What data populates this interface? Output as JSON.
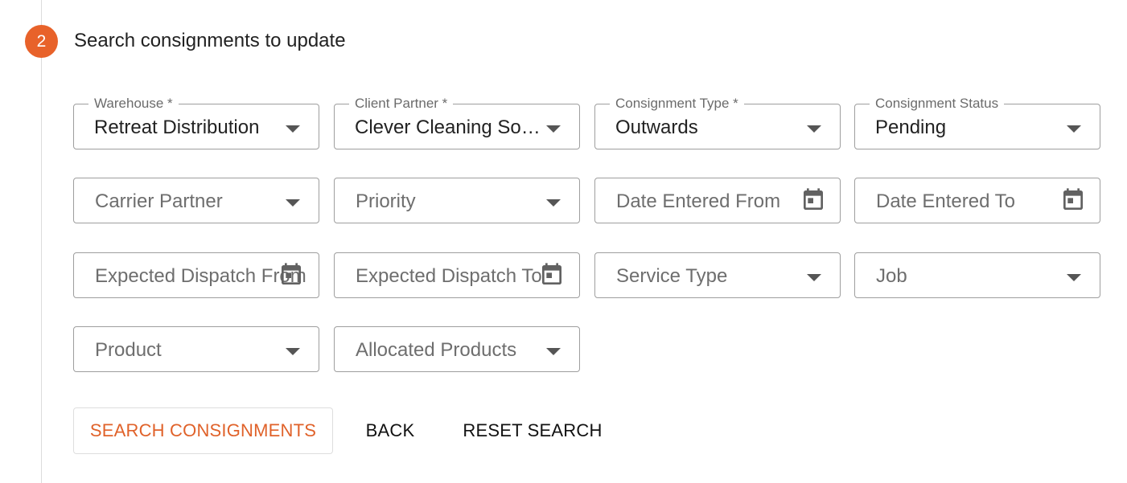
{
  "step": {
    "number": "2",
    "title": "Search consignments to update"
  },
  "row1": {
    "warehouse": {
      "label": "Warehouse *",
      "value": "Retreat Distribution"
    },
    "client_partner": {
      "label": "Client Partner *",
      "value": "Clever Cleaning Sol..."
    },
    "consignment_type": {
      "label": "Consignment Type *",
      "value": "Outwards"
    },
    "consignment_status": {
      "label": "Consignment Status",
      "value": "Pending"
    }
  },
  "row2": {
    "carrier_partner": {
      "placeholder": "Carrier Partner"
    },
    "priority": {
      "placeholder": "Priority"
    },
    "date_entered_from": {
      "placeholder": "Date Entered From"
    },
    "date_entered_to": {
      "placeholder": "Date Entered To"
    }
  },
  "row3": {
    "expected_dispatch_from": {
      "placeholder": "Expected Dispatch From"
    },
    "expected_dispatch_to": {
      "placeholder": "Expected Dispatch To"
    },
    "service_type": {
      "placeholder": "Service Type"
    },
    "job": {
      "placeholder": "Job"
    }
  },
  "row4": {
    "product": {
      "placeholder": "Product"
    },
    "allocated_products": {
      "placeholder": "Allocated Products"
    }
  },
  "actions": {
    "search_label": "SEARCH CONSIGNMENTS",
    "back_label": "BACK",
    "reset_label": "RESET SEARCH"
  },
  "colors": {
    "accent": "#e8622a",
    "border": "#9e9e9e",
    "text": "#222222"
  },
  "icons": {
    "dropdown": "caret-down-icon",
    "date": "calendar-icon"
  }
}
